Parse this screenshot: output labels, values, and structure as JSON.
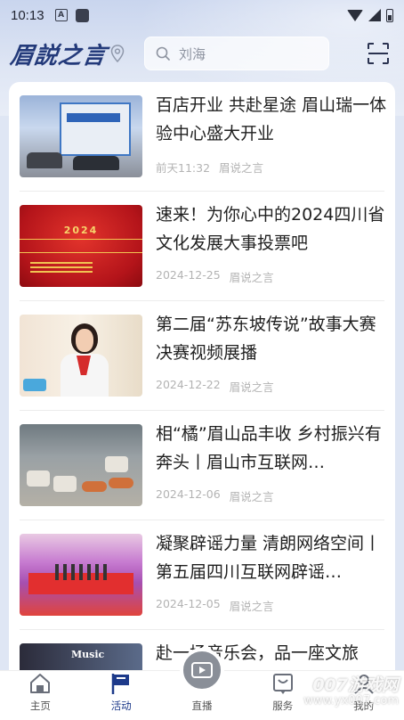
{
  "status_bar": {
    "time": "10:13",
    "a_icon": "A"
  },
  "header": {
    "logo": "眉説之言",
    "search_placeholder": "刘海"
  },
  "articles": [
    {
      "title": "百店开业 共赴星途 眉山瑞一体验中心盛大开业",
      "date": "前天11:32",
      "source": "眉说之言"
    },
    {
      "title": "速来！为你心中的2024四川省文化发展大事投票吧",
      "date": "2024-12-25",
      "source": "眉说之言",
      "thumb_text": "2024"
    },
    {
      "title": "第二届“苏东坡传说”故事大赛决赛视频展播",
      "date": "2024-12-22",
      "source": "眉说之言"
    },
    {
      "title": "相“橘”眉山品丰收 乡村振兴有奔头丨眉山市互联网…",
      "date": "2024-12-06",
      "source": "眉说之言"
    },
    {
      "title": "凝聚辟谣力量 清朗网络空间丨第五届四川互联网辟谣…",
      "date": "2024-12-05",
      "source": "眉说之言"
    },
    {
      "title": "赴一场音乐会，品一座文旅",
      "date": "",
      "source": "",
      "thumb_text": "Music"
    }
  ],
  "bottom_nav": {
    "home": "主页",
    "activity": "活动",
    "live": "直播",
    "service": "服务",
    "mine": "我的"
  },
  "watermark": {
    "line1": "007游戏网",
    "line2": "www.yx007.com"
  },
  "colors": {
    "brand": "#1d3a8a",
    "background": "#dfe6f4"
  }
}
